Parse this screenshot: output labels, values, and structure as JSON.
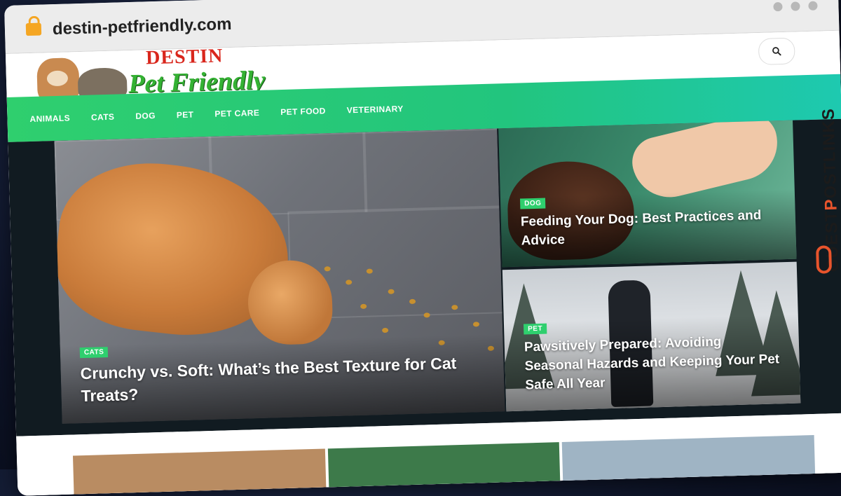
{
  "browser": {
    "url": "destin-petfriendly.com"
  },
  "logo": {
    "top_text": "DESTIN",
    "main_text": "Pet Friendly"
  },
  "nav": {
    "items": [
      "ANIMALS",
      "CATS",
      "DOG",
      "PET",
      "PET CARE",
      "PET FOOD",
      "VETERINARY"
    ]
  },
  "hero": {
    "main": {
      "category": "CATS",
      "title": "Crunchy vs. Soft: What’s the Best Texture for Cat Treats?"
    },
    "side": [
      {
        "category": "DOG",
        "title": "Feeding Your Dog: Best Practices and Advice"
      },
      {
        "category": "PET",
        "title": "Pawsitively Prepared: Avoiding Seasonal Hazards and Keeping Your Pet Safe All Year"
      }
    ]
  },
  "brand": {
    "vertical_pre": "GUEST",
    "vertical_o": "P",
    "vertical_post": "OSTLINKS"
  },
  "colors": {
    "nav_start": "#2fcf6e",
    "nav_end": "#1ec9b0",
    "badge": "#2fcf6e",
    "logo_red": "#d9261c",
    "logo_green": "#34b233",
    "brand_accent": "#e8542c",
    "hero_bg": "#111b21"
  },
  "icons": {
    "lock": "lock-icon",
    "search": "search-icon",
    "window_controls": "window-dot-icon",
    "chain": "chain-link-icon"
  }
}
